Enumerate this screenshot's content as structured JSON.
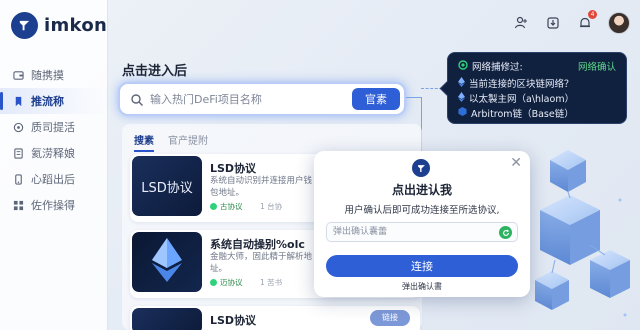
{
  "app": {
    "brand": "imkon"
  },
  "sidebar": {
    "items": [
      {
        "label": "随携摸",
        "icon": "wallet-icon",
        "active": false
      },
      {
        "label": "推流称",
        "icon": "bookmark-icon",
        "active": true
      },
      {
        "label": "质司提活",
        "icon": "coin-icon",
        "active": false
      },
      {
        "label": "氦涝释娘",
        "icon": "document-icon",
        "active": false
      },
      {
        "label": "心蹈出后",
        "icon": "phone-icon",
        "active": false
      },
      {
        "label": "佐作操得",
        "icon": "grid-icon",
        "active": false
      }
    ]
  },
  "topbar": {
    "notification_count": "4",
    "icons": [
      "person-plus-icon",
      "download-icon",
      "bell-icon",
      "avatar"
    ]
  },
  "main": {
    "title": "点击进入后",
    "search": {
      "placeholder": "输入热门DeFi项目名称",
      "button_label": "官素"
    },
    "tabs": [
      {
        "label": "搜素",
        "active": true
      },
      {
        "label": "官产提附",
        "active": false
      }
    ],
    "cards": [
      {
        "thumb_text": "LSD协议",
        "title": "LSD协议",
        "desc": "系统自动识别并连接用户钱包地址。",
        "tag": "古协议",
        "meta": "1 台协",
        "pill": ""
      },
      {
        "thumb_text": "",
        "title": "系统自动操别%olc",
        "desc": "金融大师，固此精于解析地址。",
        "tag": "迈协议",
        "meta": "1 苦书",
        "pill": ""
      },
      {
        "thumb_text": "",
        "title": "LSD协议",
        "desc": "",
        "tag": "",
        "meta": "",
        "pill": "链接"
      }
    ]
  },
  "network_tip": {
    "title": "网络捕修过:",
    "confirm": "网络确认",
    "lines": [
      "当前连接的区块链网络？",
      "以太製主网（a\\hlaom）",
      "Arbitrom链（Base链）"
    ]
  },
  "modal": {
    "title": "点出进认我",
    "text": "用户确认后即可成功连接至所选协议,",
    "input_placeholder": "弹出确认囊蕾",
    "button_label": "连接",
    "footer": "弹出确认書"
  },
  "colors": {
    "accent": "#2f5fd6",
    "brand": "#1d3f8f",
    "confirm_green": "#5fd88b",
    "badge_red": "#e0473a"
  }
}
